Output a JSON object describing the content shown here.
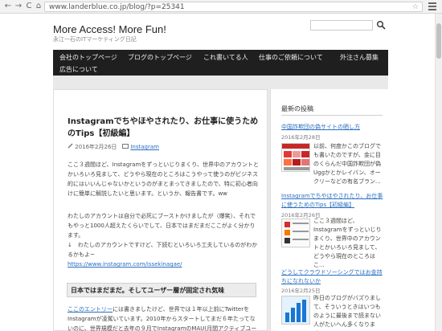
{
  "browser": {
    "url": "www.landerblue.co.jp/blog/?p=25341",
    "back_icon": "←",
    "forward_icon": "→",
    "reload_icon": "C",
    "home_icon": "⌂",
    "star_icon": "☆"
  },
  "site": {
    "title": "More Access! More Fun!",
    "description": "永江一石のITマーケティング日記"
  },
  "nav": {
    "items": [
      "会社のトップページ",
      "ブログのトップページ",
      "これ書いてる人",
      "仕事のご依頼について",
      "外注さん募集",
      "広告について"
    ]
  },
  "article": {
    "title": "Instagramでちやほやされたり、お仕事に使うためのTips【初級編】",
    "date": "2016年2月26日",
    "category": "Instagram",
    "para1": "ここ３週間ほど、Instagramをずっといじりまくり、世界中のアカウントとかいろいろ見まして、どうやら現在のところはこうやって使うのがビジネス的にはいいんじゃないかというのがまとまってきましたので、特に初心者向けに簡単に解説したいと思います。というか、報告書です。ww",
    "para2": "わたしのアカウントは自分で必死にブーストかけましたが（爆笑）、それでもやっと1000人超えたくらいでして、日本ではまだまだここがよく分かります。",
    "para3": "↓　わたしのアカウントですけど、下読むといろいろ工夫しているのがわかるかもよ~",
    "link": "https://www.instagram.com/issekinagae/",
    "section_heading": "日本ではまだまだ。そしてユーザー層が固定され気味",
    "para4_link": "ここのエントリー",
    "para4": "には書きましたけど、世界では１年以上前にTwitterをInstagramが凌駕いています。2010年からスタートしてまだ６年たってないのに、世界規模だと去年の９月でInstagramのMAU(月間アクティブユー"
  },
  "sidebar": {
    "heading": "最新の投稿",
    "posts": [
      {
        "title": "中国詐欺団の偽サイトの晒し方",
        "date": "2016年2月28日",
        "excerpt": "以前、何度かこのブログでも書いたのですが、金に目のくらんだ中国詐欺団が偽Uggかとかレイバン、オークリーなどの有名ブラン..."
      },
      {
        "title": "Instagramでちやほやされたり、お仕事に使うためのTips【初級編】",
        "date": "2016年2月26日",
        "excerpt": "ここ３週間ほど、Instagramをずっといじりまくり、世界中のアカウントとかいろいろ見まして、どうやら現在のところはこ..."
      },
      {
        "title": "どうしてクラウドソーシングではお金持ちになれないか",
        "date": "2016年2月25日",
        "excerpt": "昨日のブログがバズりまして、そういうときはいつものように最後まで読まない人がたいへん多くなります。"
      }
    ]
  },
  "colors": {
    "navbar": "#1f1f1f",
    "link": "#2a6ec0",
    "background": "#e9e9e9"
  }
}
